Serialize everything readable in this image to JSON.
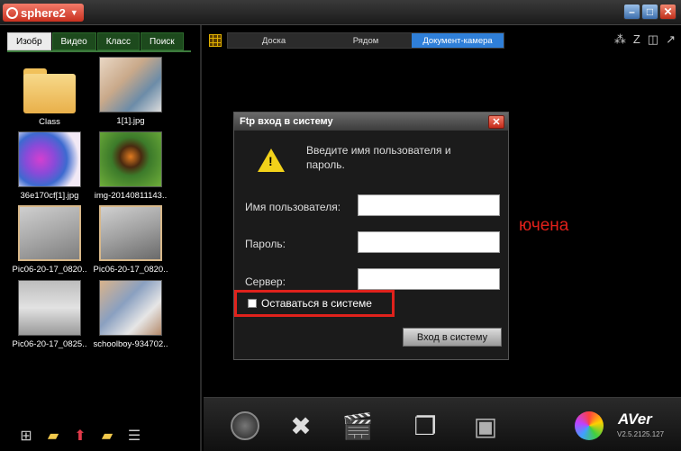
{
  "app": {
    "title": "sphere2"
  },
  "window_controls": {
    "minimize": "–",
    "maximize": "□",
    "close": "✕"
  },
  "left_panel": {
    "tabs": [
      {
        "label": "Изобр",
        "active": true
      },
      {
        "label": "Видео"
      },
      {
        "label": "Класс"
      },
      {
        "label": "Поиск"
      }
    ],
    "items": [
      {
        "caption": "Class",
        "kind": "folder"
      },
      {
        "caption": "1[1].jpg",
        "kind": "image"
      },
      {
        "caption": "36e170cf[1].jpg",
        "kind": "image"
      },
      {
        "caption": "img-20140811143..",
        "kind": "image"
      },
      {
        "caption": "Pic06-20-17_0820..",
        "kind": "image",
        "selected": true
      },
      {
        "caption": "Pic06-20-17_0820..",
        "kind": "image",
        "selected": true
      },
      {
        "caption": "Pic06-20-17_0825..",
        "kind": "image"
      },
      {
        "caption": "schoolboy-934702..",
        "kind": "image"
      }
    ]
  },
  "top_bar": {
    "modes": [
      {
        "label": "Доска"
      },
      {
        "label": "Рядом"
      },
      {
        "label": "Документ-камера",
        "active": true
      }
    ]
  },
  "background_text": "ючена",
  "dialog": {
    "title": "Ftp вход в систему",
    "message": "Введите имя пользователя и пароль.",
    "username_label": "Имя пользователя:",
    "password_label": "Пароль:",
    "server_label": "Сервер:",
    "username_value": "",
    "password_value": "",
    "server_value": "",
    "remember_label": "Оставаться в системе",
    "remember_checked": false,
    "login_button": "Вход в систему"
  },
  "brand": {
    "logo": "AVer",
    "version": "V2.5.2125.127"
  },
  "colors": {
    "accent_blue": "#2f7fd8",
    "alert_red": "#e0221c",
    "tab_green": "#1d4a1d"
  }
}
